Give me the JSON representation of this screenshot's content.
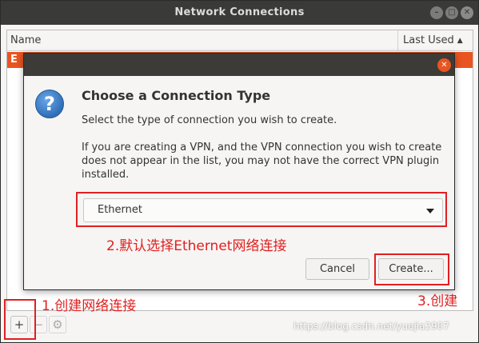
{
  "window": {
    "title": "Network Connections",
    "buttons": {
      "minimize": "–",
      "maximize": "□",
      "close": "✕"
    }
  },
  "list": {
    "col_name": "Name",
    "col_last_used": "Last Used",
    "sort_icon": "▲",
    "group_label": "E"
  },
  "toolbar": {
    "add": "+",
    "remove": "−",
    "settings_icon": "⚙"
  },
  "dialog": {
    "close": "✕",
    "icon": "?",
    "heading": "Choose a Connection Type",
    "text1": "Select the type of connection you wish to create.",
    "text2": "If you are creating a VPN, and the VPN connection you wish to create does not appear in the list, you may not have the correct VPN plugin installed.",
    "selected_type": "Ethernet",
    "cancel_label": "Cancel",
    "create_label": "Create..."
  },
  "annotations": {
    "step1": "1.创建网络连接",
    "step2": "2.默认选择Ethernet网络连接",
    "step3": "3.创建",
    "color": "#e02020"
  },
  "watermark": "https://blog.csdn.net/yuejia2907",
  "colors": {
    "accent": "#e95420",
    "titlebar": "#3a3a38"
  }
}
